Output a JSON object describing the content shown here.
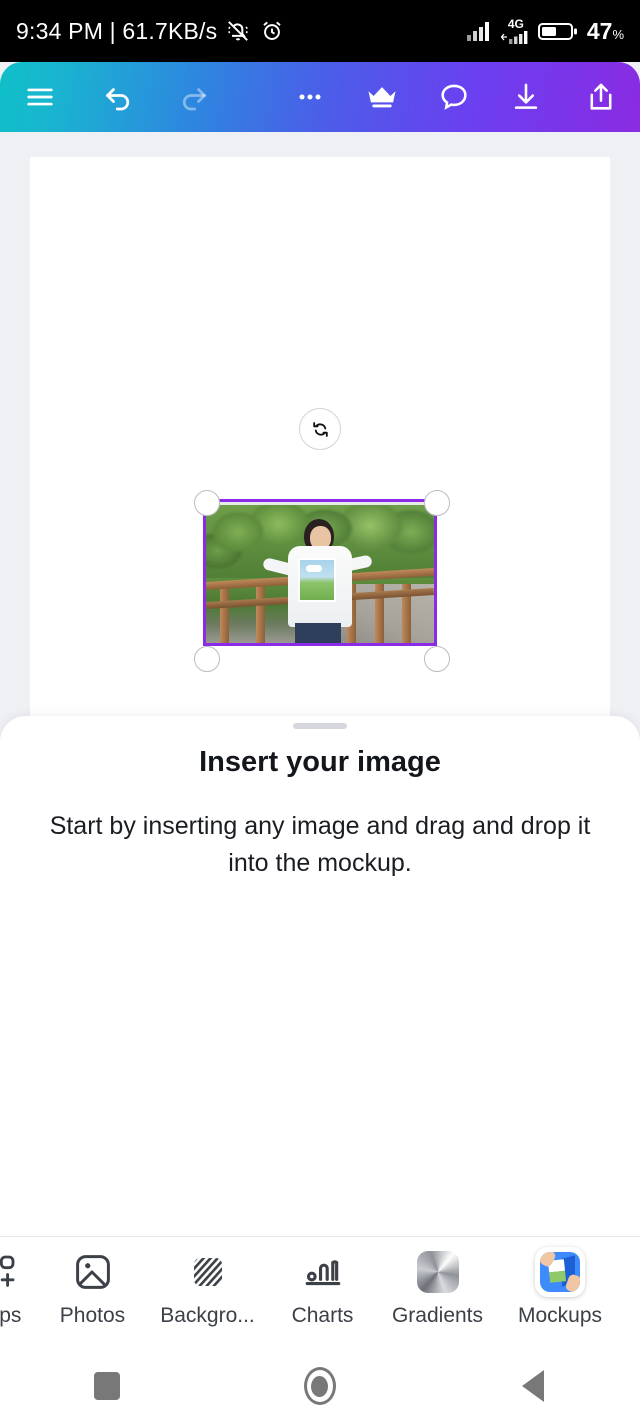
{
  "status_bar": {
    "time_and_speed": "9:34 PM | 61.7KB/s",
    "mute_icon": "bell-muted-icon",
    "alarm_icon": "alarm-clock-icon",
    "signal_icon": "signal-bars-icon",
    "network_type": "4G",
    "signal2_icon": "signal-bars-secondary-icon",
    "battery_icon": "battery-icon",
    "battery_percent": "47",
    "battery_unit": "%"
  },
  "toolbar": {
    "menu_label": "menu-icon",
    "undo_label": "undo-icon",
    "redo_label": "redo-icon",
    "more_label": "more-options-icon",
    "premium_label": "crown-icon",
    "comment_label": "comment-icon",
    "download_label": "download-icon",
    "share_label": "share-icon",
    "gradient_start": "#0fbfc8",
    "gradient_end": "#8a2be2"
  },
  "canvas": {
    "rotate_handle": "rotate-icon",
    "selection_border_color": "#8b2be8",
    "image_description": "Photo of a young person in a white t-shirt with a landscape print standing on a wooden bridge surrounded by green trees"
  },
  "sheet": {
    "title": "Insert your image",
    "description": "Start by inserting any image and drag and drop it into the mockup."
  },
  "tools": [
    {
      "label": "Apps",
      "icon": "apps-grid-plus-icon",
      "active": false
    },
    {
      "label": "Photos",
      "icon": "photo-icon",
      "active": false
    },
    {
      "label": "Backgro...",
      "icon": "background-pattern-icon",
      "active": false
    },
    {
      "label": "Charts",
      "icon": "bar-chart-icon",
      "active": false
    },
    {
      "label": "Gradients",
      "icon": "gradient-swatch-icon",
      "active": false
    },
    {
      "label": "Mockups",
      "icon": "mockups-app-icon",
      "active": true
    }
  ],
  "nav_bar": {
    "recents_label": "recents-icon",
    "home_label": "home-icon",
    "back_label": "back-icon"
  }
}
